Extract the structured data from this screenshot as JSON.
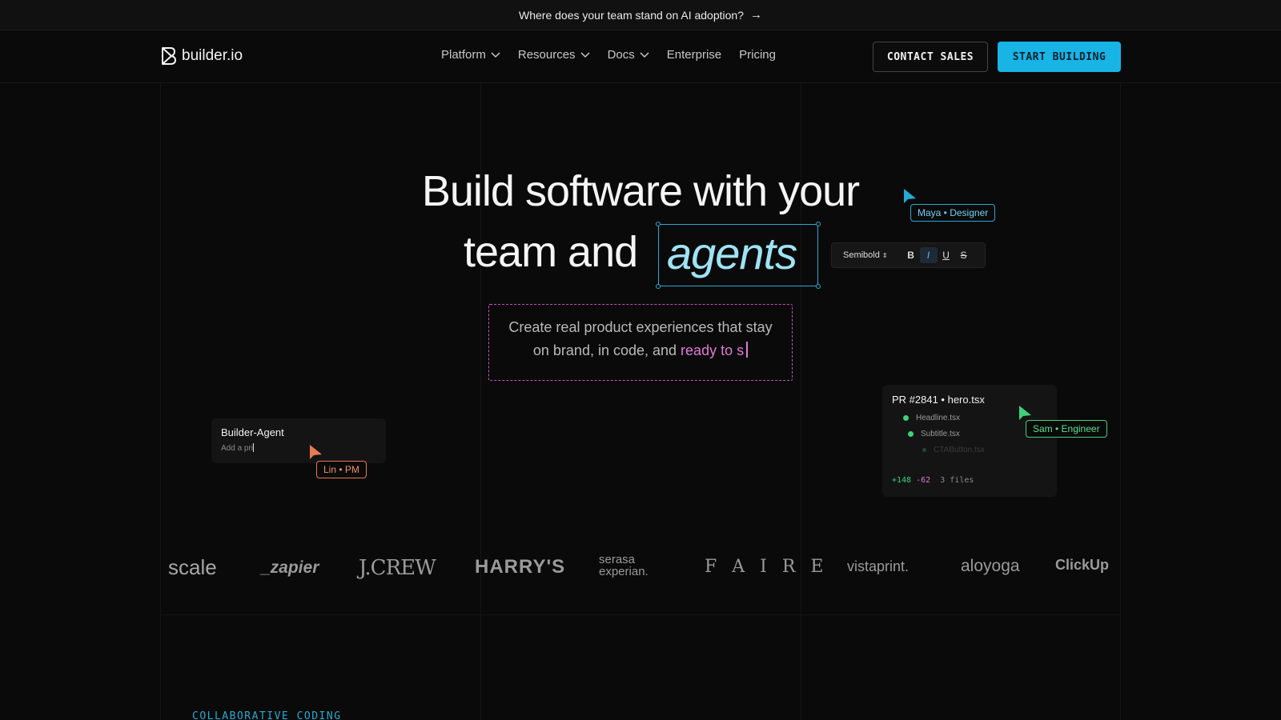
{
  "announcement": {
    "text": "Where does your team stand on AI adoption?",
    "arrow": "→"
  },
  "nav": {
    "logo_text": "builder.io",
    "menu": [
      "Platform",
      "Resources",
      "Docs",
      "Enterprise",
      "Pricing"
    ],
    "contact_label": "CONTACT SALES",
    "start_label": "START BUILDING"
  },
  "hero": {
    "title_line1": "Build software with your",
    "title_line2_prefix": "team and",
    "title_highlight": "agents",
    "subtitle_line1": "Create real product experiences that stay",
    "subtitle_line2_prefix": "on brand, in code, and",
    "subtitle_typing": "ready to s"
  },
  "format_toolbar": {
    "weight": "Semibold",
    "bold": "B",
    "italic": "I",
    "underline": "U",
    "strike": "S"
  },
  "collaborators": {
    "maya": "Maya • Designer",
    "sam": "Sam • Engineer",
    "lin": "Lin • PM"
  },
  "agent_card": {
    "title": "Builder-Agent",
    "input": "Add a pri"
  },
  "pr_card": {
    "title": "PR #2841 • hero.tsx",
    "files": [
      "Headline.tsx",
      "Subtitle.tsx",
      "CTAButton.tsx"
    ],
    "additions": "+148",
    "deletions": "-62",
    "files_count": "3 files"
  },
  "brands": [
    "scale",
    "_zapier",
    "J.CREW",
    "HARRY'S",
    "serasa experian.",
    "F A I R E",
    "vistaprint.",
    "aloyoga",
    "ClickUp"
  ],
  "section": {
    "label": "COLLABORATIVE CODING"
  },
  "colors": {
    "accent": "#18b4e6",
    "pink": "#e07ad8",
    "green": "#3fd17a",
    "orange": "#e67a55"
  }
}
